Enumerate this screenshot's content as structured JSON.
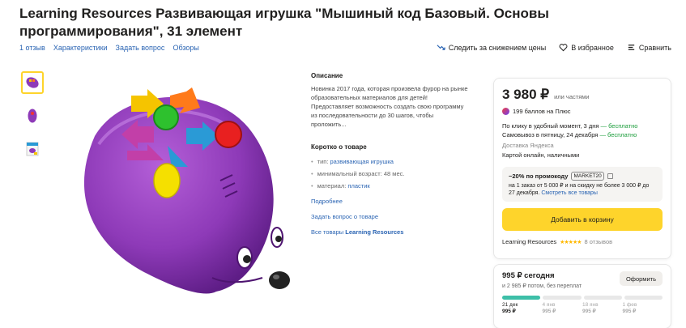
{
  "title": "Learning Resources Развивающая игрушка \"Мышиный код Базовый. Основы программирования\", 31 элемент",
  "subnav": [
    "1 отзыв",
    "Характеристики",
    "Задать вопрос",
    "Обзоры"
  ],
  "actions": {
    "price_alert": "Следить за снижением цены",
    "favorite": "В избранное",
    "compare": "Сравнить"
  },
  "description": {
    "heading": "Описание",
    "text": "Новинка 2017 года, которая произвела фурор на рынке образовательных материалов для детей! Предоставляет возможность создать свою программу из последовательности до 30 шагов, чтобы проложить...",
    "brief_heading": "Коротко о товаре",
    "specs": [
      {
        "label": "тип:",
        "value": "развивающая игрушка"
      },
      {
        "label": "минимальный возраст:",
        "value": "48 мес."
      },
      {
        "label": "материал:",
        "value": "пластик"
      }
    ],
    "more": "Подробнее",
    "ask": "Задать вопрос о товаре",
    "all_goods_prefix": "Все товары",
    "brand": "Learning Resources"
  },
  "buybox": {
    "price": "3 980 ₽",
    "installments": "или частями",
    "plus_points": "199 баллов на Плюс",
    "delivery_line1_a": "По клику в удобный момент, 3 дня",
    "delivery_line1_b": "— бесплатно",
    "delivery_line2_a": "Самовывоз в пятницу, 24 декабря",
    "delivery_line2_b": "— бесплатно",
    "delivery_service": "Доставка Яндекса",
    "payment": "Картой онлайн, наличными",
    "promo_title": "−20% по промокоду",
    "promo_code": "MARKET20",
    "promo_text": "на 1 заказ от 5 000 ₽ и на скидку не более 3 000 ₽ до 27 декабря.",
    "promo_link": "Смотреть все товары",
    "cart_button": "Добавить в корзину",
    "seller": "Learning Resources",
    "stars": "★★★★★",
    "reviews": "8 отзывов"
  },
  "split": {
    "today": "995 ₽ сегодня",
    "later": "и 2 985 ₽ потом, без переплат",
    "button": "Оформить",
    "schedule": [
      {
        "date": "21 дек",
        "amount": "995 ₽"
      },
      {
        "date": "4 янв",
        "amount": "995 ₽"
      },
      {
        "date": "18 янв",
        "amount": "995 ₽"
      },
      {
        "date": "1 фев",
        "amount": "995 ₽"
      }
    ],
    "paid_segments": 1
  },
  "colors": {
    "accent_yellow": "#fed42b",
    "link_blue": "#2a64b3",
    "free_green": "#1a9c3a",
    "toy_purple": "#8e3ab8"
  }
}
